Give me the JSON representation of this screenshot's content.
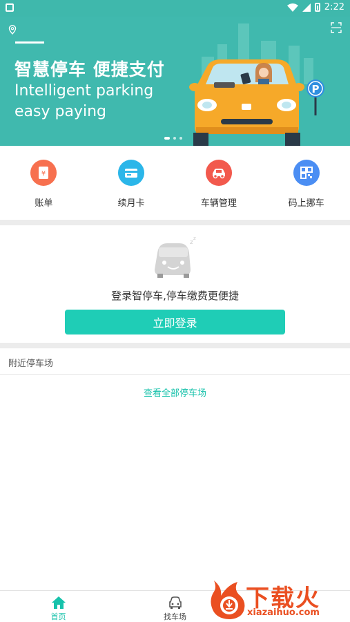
{
  "status_bar": {
    "time": "2:22"
  },
  "banner": {
    "title": "智慧停车 便捷支付",
    "subtitle_line1": "Intelligent parking",
    "subtitle_line2": "easy paying",
    "parking_sign": "P",
    "page_indicator": {
      "total": 3,
      "active": 1
    }
  },
  "quick_actions": [
    {
      "label": "账单",
      "icon": "bill-icon",
      "color": "#f7704f"
    },
    {
      "label": "续月卡",
      "icon": "card-icon",
      "color": "#2bb6e9"
    },
    {
      "label": "车辆管理",
      "icon": "car-icon",
      "color": "#f2594d"
    },
    {
      "label": "码上挪车",
      "icon": "qr-code-icon",
      "color": "#4b8ef3"
    }
  ],
  "login_card": {
    "message": "登录智停车,停车缴费更便捷",
    "button_label": "立即登录"
  },
  "nearby": {
    "section_title": "附近停车场",
    "view_all_label": "查看全部停车场"
  },
  "tabbar": {
    "tabs": [
      {
        "label": "首页",
        "icon": "home-icon",
        "active": true
      },
      {
        "label": "找车场",
        "icon": "car-front-icon",
        "active": false
      }
    ]
  },
  "watermark": {
    "brand": "下载火",
    "domain": "xiazaihuo.com"
  },
  "colors": {
    "primary": "#40b9ae",
    "accent": "#1fcdb6",
    "link": "#17c2ab"
  }
}
